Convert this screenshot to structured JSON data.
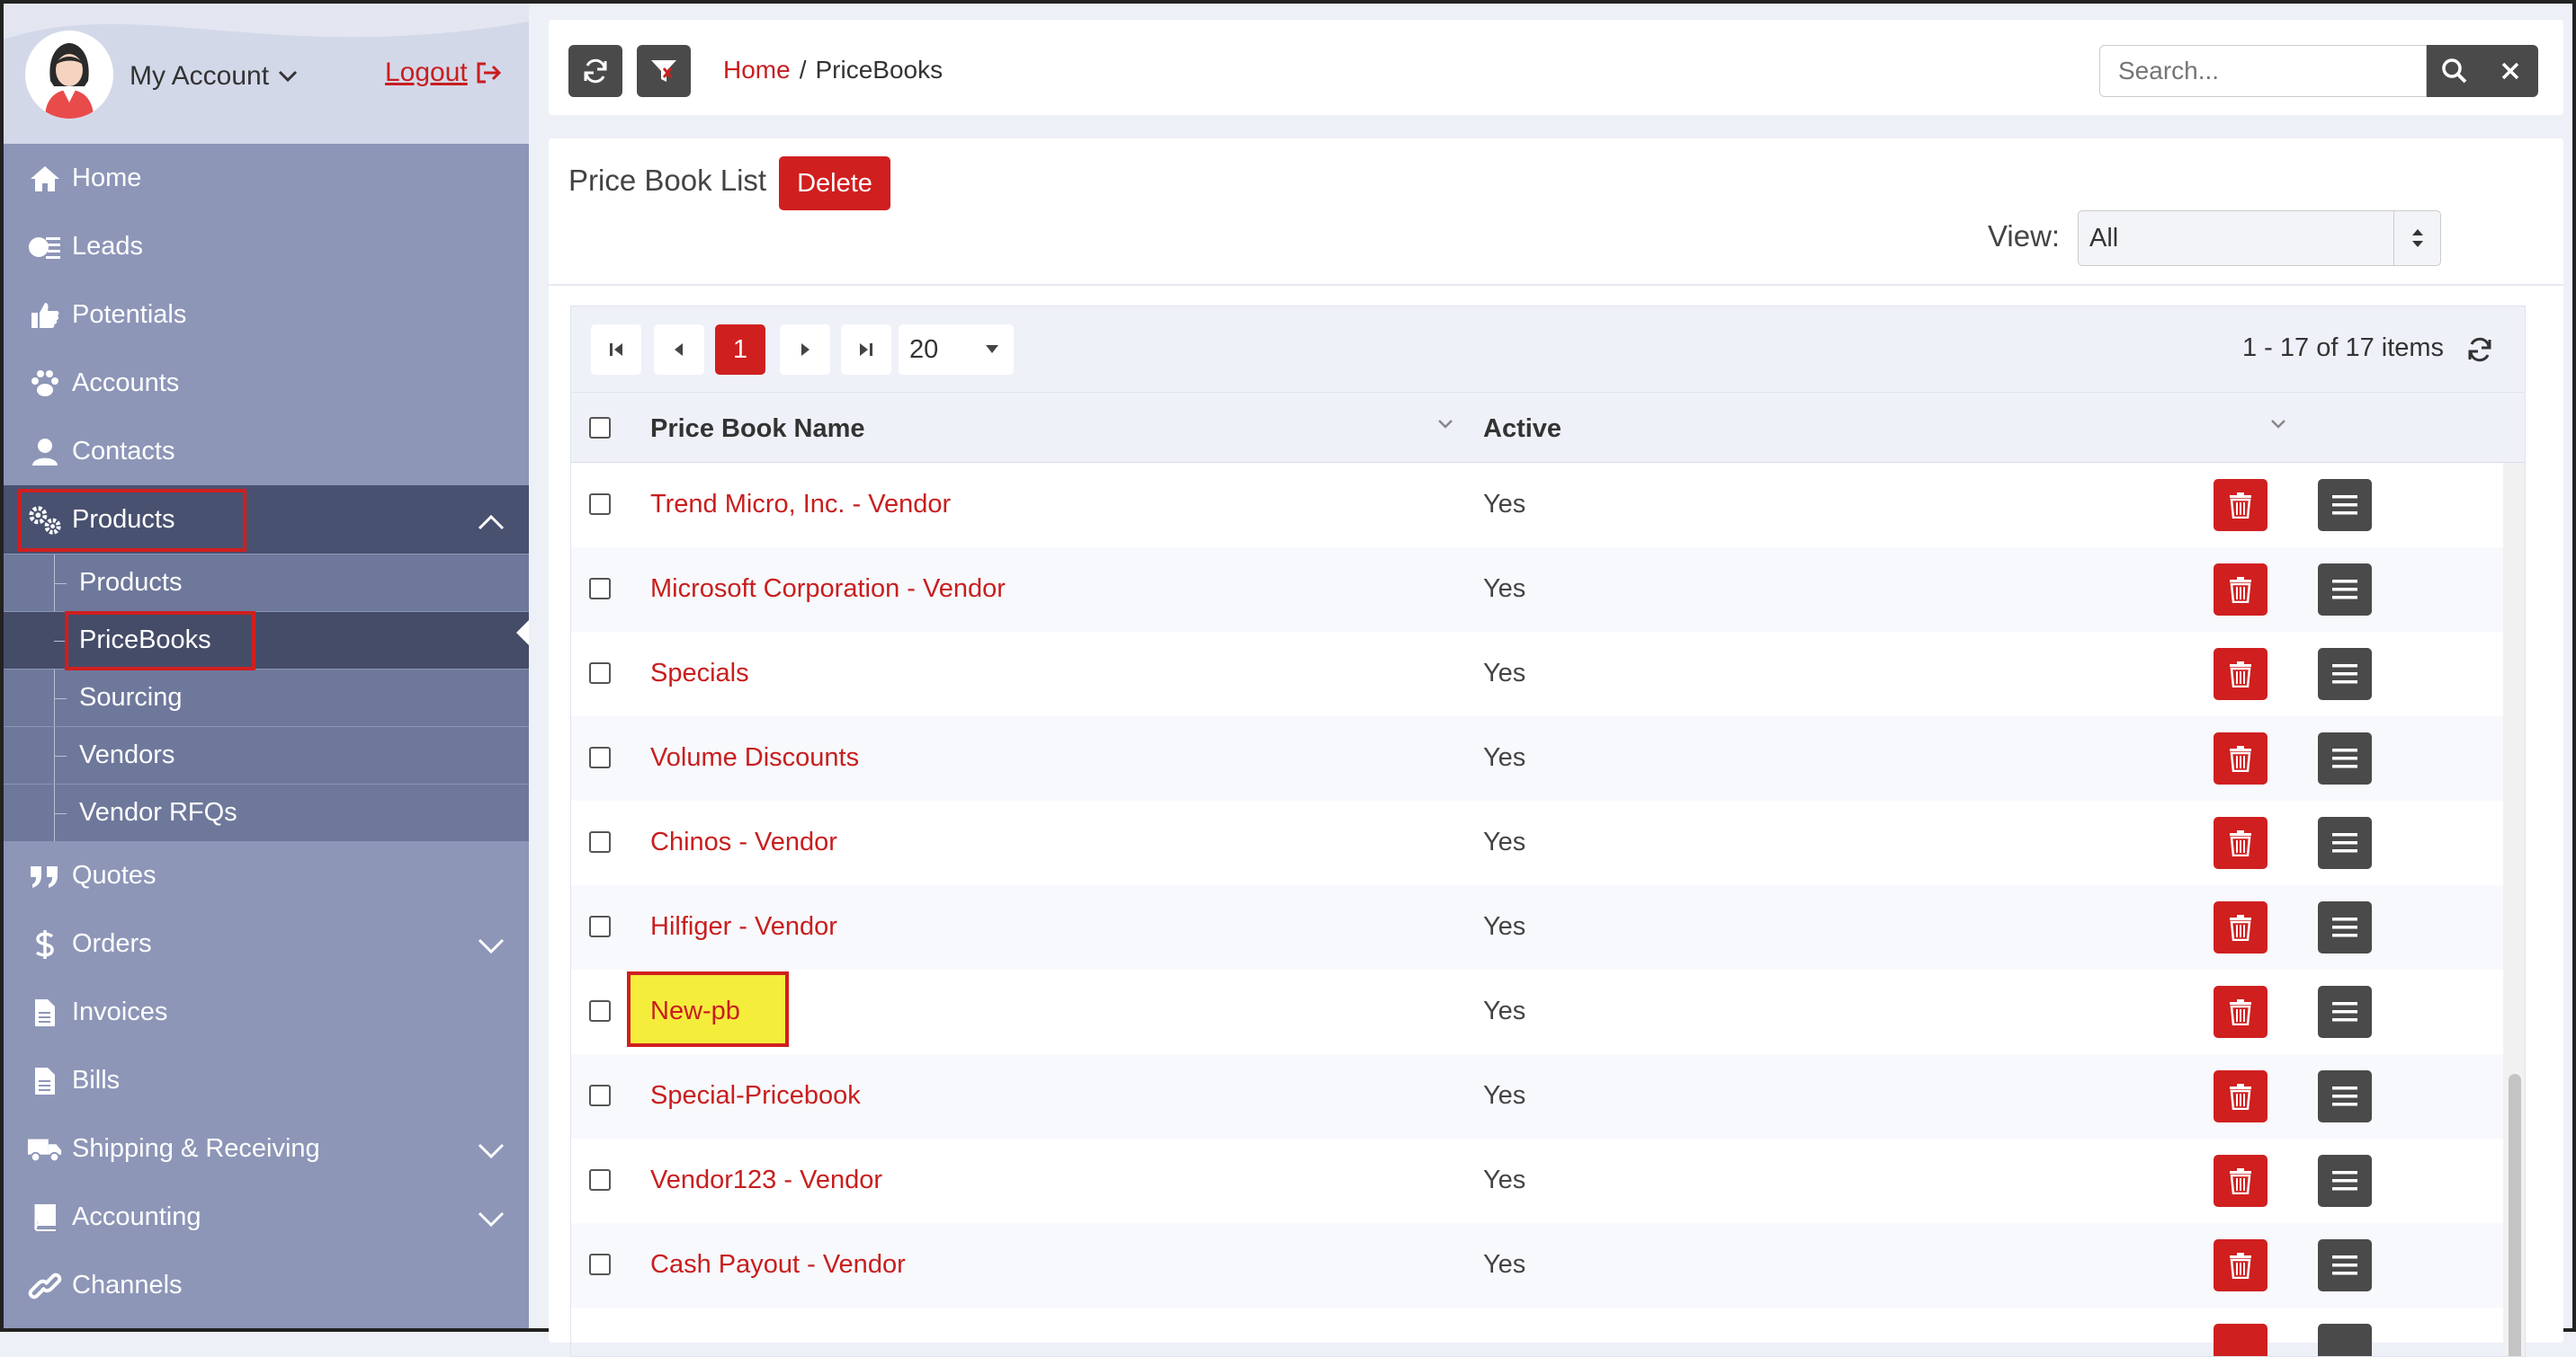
{
  "account": {
    "label": "My Account",
    "logout": "Logout"
  },
  "sidebar": {
    "items": [
      {
        "label": "Home",
        "icon": "home-icon"
      },
      {
        "label": "Leads",
        "icon": "leads-icon"
      },
      {
        "label": "Potentials",
        "icon": "thumbs-up-icon"
      },
      {
        "label": "Accounts",
        "icon": "paw-icon"
      },
      {
        "label": "Contacts",
        "icon": "user-icon"
      },
      {
        "label": "Products",
        "icon": "gears-icon"
      },
      {
        "label": "Quotes",
        "icon": "quote-icon"
      },
      {
        "label": "Orders",
        "icon": "dollar-icon"
      },
      {
        "label": "Invoices",
        "icon": "file-icon"
      },
      {
        "label": "Bills",
        "icon": "file-icon"
      },
      {
        "label": "Shipping & Receiving",
        "icon": "truck-icon"
      },
      {
        "label": "Accounting",
        "icon": "book-icon"
      },
      {
        "label": "Channels",
        "icon": "link-icon"
      }
    ],
    "products_sub": [
      "Products",
      "PriceBooks",
      "Sourcing",
      "Vendors",
      "Vendor RFQs"
    ]
  },
  "breadcrumb": {
    "home": "Home",
    "sep": "/",
    "current": "PriceBooks"
  },
  "search": {
    "placeholder": "Search..."
  },
  "main": {
    "title": "Price Book List",
    "delete_label": "Delete",
    "view_label": "View:",
    "view_value": "All"
  },
  "pager": {
    "current_page": "1",
    "page_size": "20",
    "items_info": "1 - 17 of 17 items"
  },
  "table": {
    "columns": [
      "Price Book Name",
      "Active"
    ],
    "rows": [
      {
        "name": "Trend Micro, Inc. - Vendor",
        "active": "Yes"
      },
      {
        "name": "Microsoft Corporation - Vendor",
        "active": "Yes"
      },
      {
        "name": "Specials",
        "active": "Yes"
      },
      {
        "name": "Volume Discounts",
        "active": "Yes"
      },
      {
        "name": "Chinos - Vendor",
        "active": "Yes"
      },
      {
        "name": "Hilfiger - Vendor",
        "active": "Yes"
      },
      {
        "name": "New-pb",
        "active": "Yes"
      },
      {
        "name": "Special-Pricebook",
        "active": "Yes"
      },
      {
        "name": "Vendor123 - Vendor",
        "active": "Yes"
      },
      {
        "name": "Cash Payout - Vendor",
        "active": "Yes"
      }
    ]
  },
  "colors": {
    "accent": "#d01f1f",
    "sidebar": "#8d96b7",
    "sidebar_active": "#495170",
    "dark_button": "#4a4a4a",
    "highlight": "#f5ed3c"
  }
}
